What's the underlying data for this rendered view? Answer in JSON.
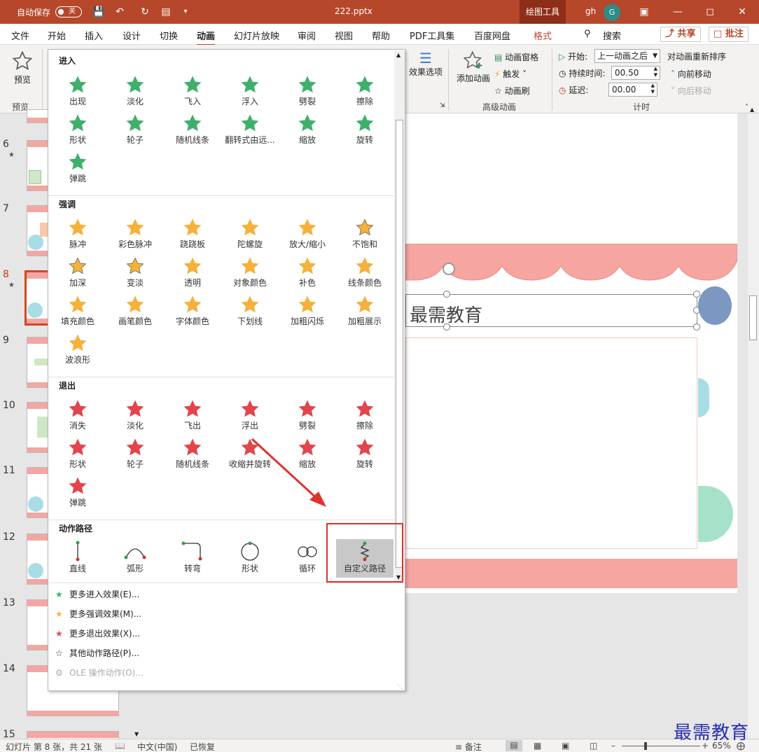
{
  "titlebar": {
    "autosave_label": "自动保存",
    "autosave_state": "关",
    "filename": "222.pptx",
    "context_tab": "绘图工具",
    "user": "gh",
    "avatar_letter": "G"
  },
  "tabs": [
    "文件",
    "开始",
    "插入",
    "设计",
    "切换",
    "动画",
    "幻灯片放映",
    "审阅",
    "视图",
    "帮助",
    "PDF工具集",
    "百度网盘",
    "格式"
  ],
  "active_tab": "动画",
  "search_label": "搜索",
  "share_label": "共享",
  "comment_label": "批注",
  "ribbon": {
    "preview_label": "预览",
    "preview_group": "预览",
    "effect_options": "效果选项",
    "add_animation": "添加动画",
    "animation_pane": "动画窗格",
    "trigger": "触发",
    "animation_painter": "动画刷",
    "advanced_group": "高级动画",
    "start_label": "开始:",
    "start_value": "上一动画之后",
    "duration_label": "持续时间:",
    "duration_value": "00.50",
    "delay_label": "延迟:",
    "delay_value": "00.00",
    "reorder_label": "对动画重新排序",
    "move_earlier": "向前移动",
    "move_later": "向后移动",
    "timing_group": "计时"
  },
  "gallery": {
    "entrance_header": "进入",
    "entrance": [
      "出现",
      "淡化",
      "飞入",
      "浮入",
      "劈裂",
      "擦除",
      "形状",
      "轮子",
      "随机线条",
      "翻转式由远...",
      "缩放",
      "旋转",
      "弹跳"
    ],
    "emphasis_header": "强调",
    "emphasis": [
      "脉冲",
      "彩色脉冲",
      "跷跷板",
      "陀螺旋",
      "放大/缩小",
      "不饱和",
      "加深",
      "变淡",
      "透明",
      "对象颜色",
      "补色",
      "线条颜色",
      "填充颜色",
      "画笔颜色",
      "字体颜色",
      "下划线",
      "加粗闪烁",
      "加粗展示",
      "波浪形"
    ],
    "exit_header": "退出",
    "exit": [
      "消失",
      "淡化",
      "飞出",
      "浮出",
      "劈裂",
      "擦除",
      "形状",
      "轮子",
      "随机线条",
      "收缩并旋转",
      "缩放",
      "旋转",
      "弹跳"
    ],
    "path_header": "动作路径",
    "paths": [
      "直线",
      "弧形",
      "转弯",
      "形状",
      "循环",
      "自定义路径"
    ],
    "more": [
      "更多进入效果(E)...",
      "更多强调效果(M)...",
      "更多退出效果(X)...",
      "其他动作路径(P)...",
      "OLE 操作动作(O)..."
    ]
  },
  "thumbnails": [
    "6",
    "7",
    "8",
    "9",
    "10",
    "11",
    "12",
    "13",
    "14",
    "15"
  ],
  "current_slide_index": 2,
  "slide_title_text": "最需教育",
  "status": {
    "slide_info": "幻灯片 第 8 张，共 21 张",
    "language": "中文(中国)",
    "recovered": "已恢复",
    "notes": "备注",
    "zoom": "65%"
  },
  "watermark": "最需教育",
  "colors": {
    "accent": "#b7472a",
    "entrance_star": "#3fb06b",
    "emphasis_star": "#f5b13a",
    "exit_star": "#e4444c",
    "highlight": "#e0312c"
  }
}
